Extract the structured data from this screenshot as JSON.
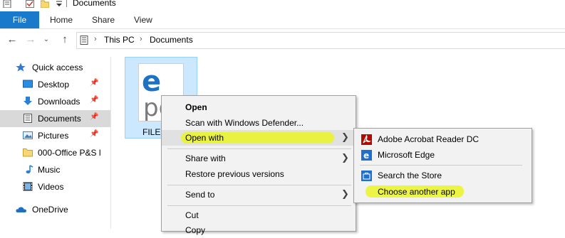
{
  "window": {
    "title": "Documents"
  },
  "ribbon": {
    "tabs": [
      "File",
      "Home",
      "Share",
      "View"
    ]
  },
  "address": {
    "crumbs": [
      "This PC",
      "Documents"
    ],
    "sep": "›"
  },
  "nav": {
    "items": [
      {
        "label": "Quick access"
      },
      {
        "label": "Desktop"
      },
      {
        "label": "Downloads"
      },
      {
        "label": "Documents"
      },
      {
        "label": "Pictures"
      },
      {
        "label": "000-Office P&S l"
      },
      {
        "label": "Music"
      },
      {
        "label": "Videos"
      },
      {
        "label": "OneDrive"
      }
    ]
  },
  "file": {
    "name": "FILEN"
  },
  "context_menu": {
    "items": [
      "Open",
      "Scan with Windows Defender...",
      "Open with",
      "Share with",
      "Restore previous versions",
      "Send to",
      "Cut",
      "Copy"
    ]
  },
  "submenu": {
    "items": [
      "Adobe Acrobat Reader DC",
      "Microsoft Edge",
      "Search the Store",
      "Choose another app"
    ]
  },
  "colors": {
    "accent": "#1979ca",
    "highlight": "#ebf514"
  }
}
